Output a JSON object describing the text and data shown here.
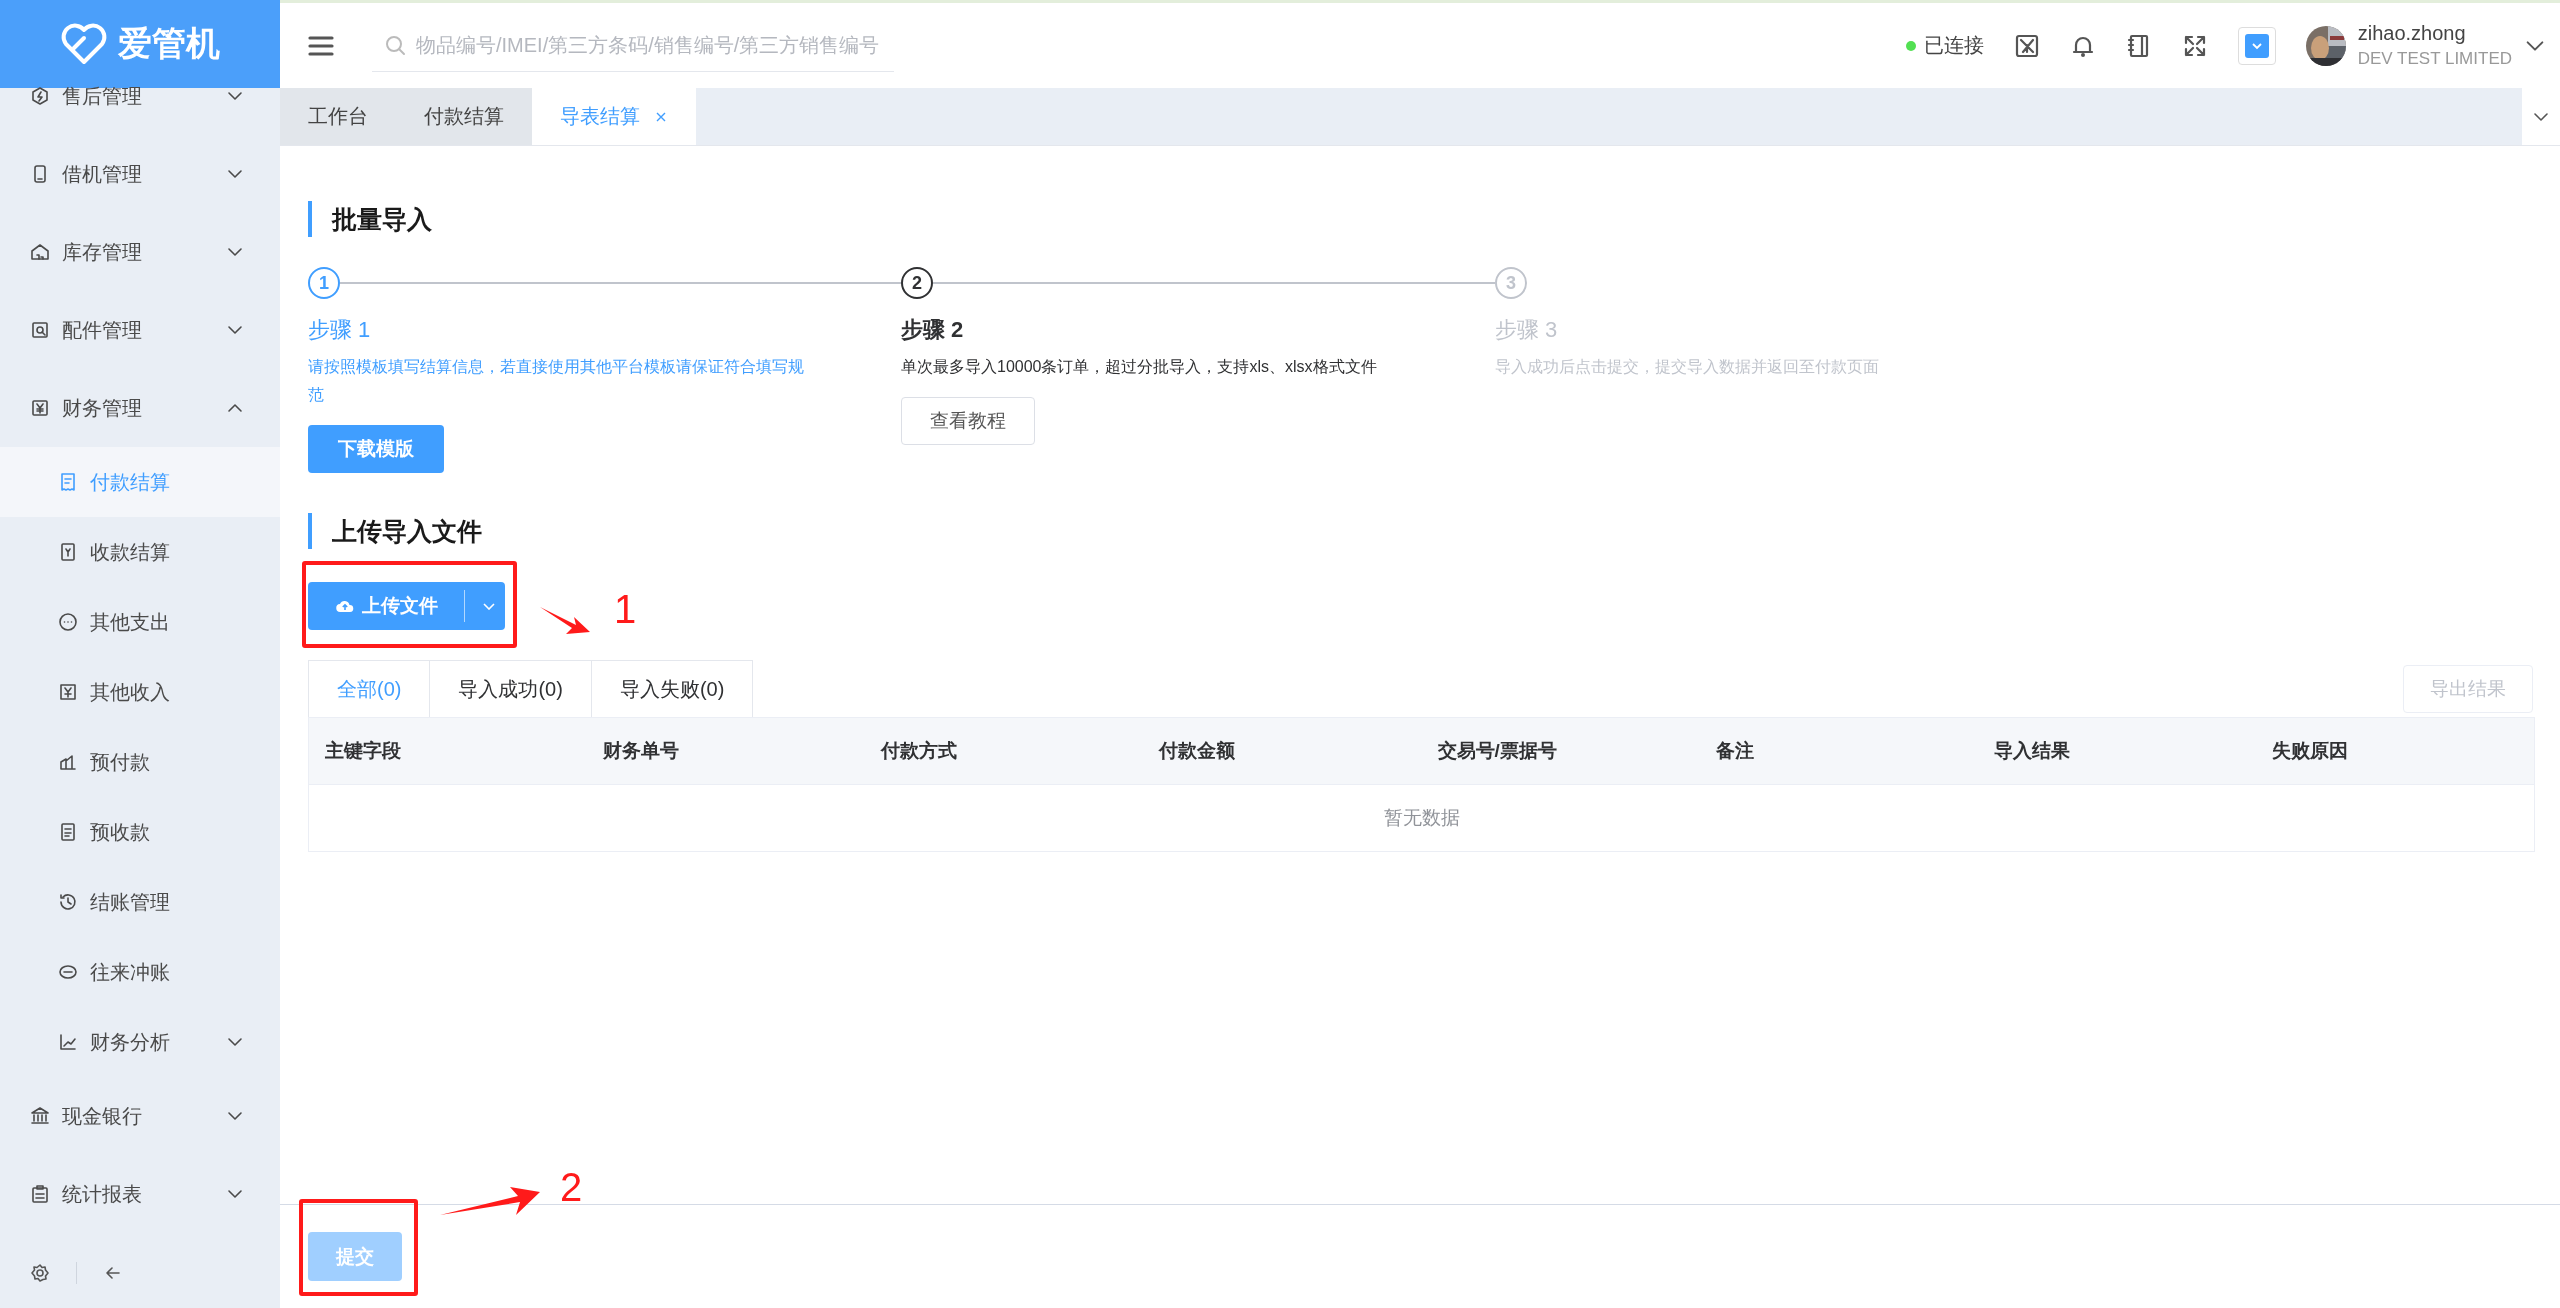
{
  "logo": {
    "text": "爱管机"
  },
  "sidebar": {
    "items": [
      {
        "label": "售后管理",
        "kind": "group",
        "expanded": false
      },
      {
        "label": "借机管理",
        "kind": "group",
        "expanded": false
      },
      {
        "label": "库存管理",
        "kind": "group",
        "expanded": false
      },
      {
        "label": "配件管理",
        "kind": "group",
        "expanded": false
      },
      {
        "label": "财务管理",
        "kind": "group",
        "expanded": true,
        "children": [
          {
            "label": "付款结算",
            "kind": "link",
            "selected": true
          },
          {
            "label": "收款结算",
            "kind": "link",
            "selected": false
          },
          {
            "label": "其他支出",
            "kind": "link",
            "selected": false
          },
          {
            "label": "其他收入",
            "kind": "link",
            "selected": false
          },
          {
            "label": "预付款",
            "kind": "link",
            "selected": false
          },
          {
            "label": "预收款",
            "kind": "link",
            "selected": false
          },
          {
            "label": "结账管理",
            "kind": "link",
            "selected": false
          },
          {
            "label": "往来冲账",
            "kind": "link",
            "selected": false
          },
          {
            "label": "财务分析",
            "kind": "group",
            "expanded": false,
            "selected": false
          }
        ]
      },
      {
        "label": "现金银行",
        "kind": "group",
        "expanded": false
      },
      {
        "label": "统计报表",
        "kind": "group",
        "expanded": false
      }
    ]
  },
  "header": {
    "search": {
      "placeholder": "物品编号/IMEI/第三方条码/销售编号/第三方销售编号"
    },
    "connection": {
      "label": "已连接",
      "color": "#52e052"
    },
    "user": {
      "name": "zihao.zhong",
      "company": "DEV TEST LIMITED"
    }
  },
  "tabs": [
    {
      "label": "工作台",
      "selected": false,
      "closable": false
    },
    {
      "label": "付款结算",
      "selected": false,
      "closable": false
    },
    {
      "label": "导表结算",
      "selected": true,
      "closable": true
    }
  ],
  "import_section": {
    "title": "批量导入",
    "steps": [
      {
        "number": "1",
        "title": "步骤 1",
        "description": "请按照模板填写结算信息，若直接使用其他平台模板请保证符合填写规范",
        "done": true,
        "current": false,
        "button": {
          "label": "下载模版",
          "kind": "primary"
        }
      },
      {
        "number": "2",
        "title": "步骤 2",
        "description": "单次最多导入10000条订单，超过分批导入，支持xls、xlsx格式文件",
        "done": false,
        "current": true,
        "button": {
          "label": "查看教程",
          "kind": "default"
        }
      },
      {
        "number": "3",
        "title": "步骤 3",
        "description": "导入成功后点击提交，提交导入数据并返回至付款页面",
        "done": false,
        "current": false
      }
    ]
  },
  "upload_section": {
    "title": "上传导入文件",
    "upload_button": {
      "label": "上传文件"
    },
    "result_tabs": [
      {
        "label": "全部(0)",
        "selected": true
      },
      {
        "label": "导入成功(0)",
        "selected": false
      },
      {
        "label": "导入失败(0)",
        "selected": false
      }
    ],
    "export_button": {
      "label": "导出结果",
      "disabled": true
    },
    "table": {
      "columns": [
        "主键字段",
        "财务单号",
        "付款方式",
        "付款金额",
        "交易号/票据号",
        "备注",
        "导入结果",
        "失败原因"
      ],
      "empty_text": "暂无数据"
    }
  },
  "footer": {
    "submit_button": {
      "label": "提交",
      "disabled": true
    }
  },
  "annotations": [
    {
      "number": "1"
    },
    {
      "number": "2"
    }
  ]
}
